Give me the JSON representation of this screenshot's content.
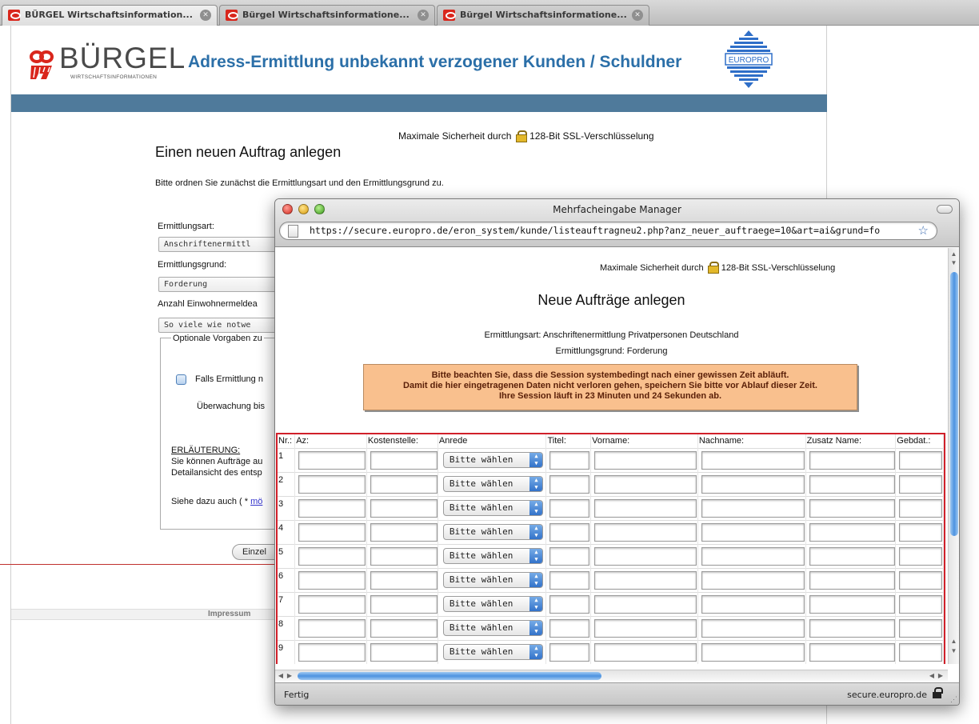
{
  "tabs": [
    {
      "label": "BÜRGEL Wirtschaftsinformation..."
    },
    {
      "label": "Bürgel Wirtschaftsinformatione..."
    },
    {
      "label": "Bürgel Wirtschaftsinformatione..."
    }
  ],
  "header": {
    "logo_text": "BÜRGEL",
    "logo_sub": "WIRTSCHAFTSINFORMATIONEN",
    "title": "Adress-Ermittlung unbekannt verzogener Kunden / Schuldner",
    "europro_label": "EUROPRO"
  },
  "page": {
    "ssl_prefix": "Maximale Sicherheit durch",
    "ssl_suffix": "128-Bit SSL-Verschlüsselung",
    "heading": "Einen neuen Auftrag anlegen",
    "intro": "Bitte ordnen Sie zunächst die Ermittlungsart und den Ermittlungsgrund zu.",
    "ermittlungsart_label": "Ermittlungsart:",
    "ermittlungsart_value": "Anschriftenermittl",
    "ermittlungsgrund_label": "Ermittlungsgrund:",
    "ermittlungsgrund_value": "Forderung",
    "anzahl_label": "Anzahl Einwohnermeldea",
    "anzahl_value": "So viele wie notwe",
    "optional_legend": "Optionale Vorgaben zu",
    "falls_text": "Falls Ermittlung n",
    "ueberwachung_text": "Überwachung bis",
    "erlaeuterung_title": "ERLÄUTERUNG:",
    "erlaeuterung_line1": "Sie können Aufträge au",
    "erlaeuterung_line2": "Detailansicht des entsp",
    "siehe_prefix": "Siehe dazu auch ( * ",
    "siehe_link": "mö",
    "einzel_button": "Einzel",
    "impressum": "Impressum"
  },
  "popup": {
    "window_title": "Mehrfacheingabe Manager",
    "url": "https://secure.europro.de/eron_system/kunde/listeauftragneu2.php?anz_neuer_auftraege=10&art=ai&grund=fo",
    "ssl_prefix": "Maximale Sicherheit durch",
    "ssl_suffix": "128-Bit SSL-Verschlüsselung",
    "title": "Neue Aufträge anlegen",
    "ermittlungsart": "Ermittlungsart: Anschriftenermittlung Privatpersonen Deutschland",
    "ermittlungsgrund": "Ermittlungsgrund: Forderung",
    "notice": [
      "Bitte beachten Sie, dass die Session systembedingt nach einer gewissen Zeit abläuft.",
      "Damit die hier eingetragenen Daten nicht verloren gehen, speichern Sie bitte vor Ablauf dieser Zeit.",
      "Ihre Session läuft in 23 Minuten und 24 Sekunden ab."
    ],
    "columns": [
      "Nr.:",
      "Az:",
      "Kostenstelle:",
      "Anrede",
      "Titel:",
      "Vorname:",
      "Nachname:",
      "Zusatz Name:",
      "Gebdat.:"
    ],
    "rows": [
      "1",
      "2",
      "3",
      "4",
      "5",
      "6",
      "7",
      "8",
      "9",
      ""
    ],
    "anrede_placeholder": "Bitte wählen",
    "status_left": "Fertig",
    "status_right": "secure.europro.de"
  },
  "colors": {
    "brand_red": "#d9261c",
    "title_blue": "#2b6fa8",
    "band_blue": "#4f7a9b",
    "notice_bg": "#f9c08e",
    "highlight_red": "#d0202a",
    "select_arrow_blue": "#2f6fc8"
  }
}
